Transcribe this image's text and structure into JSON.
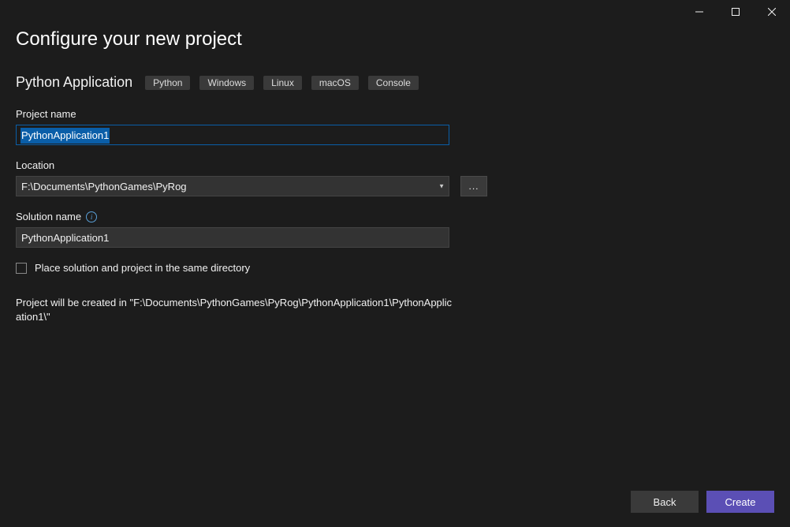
{
  "window": {
    "minimize": "–",
    "maximize": "☐",
    "close": "✕"
  },
  "heading": "Configure your new project",
  "template": {
    "name": "Python Application",
    "tags": [
      "Python",
      "Windows",
      "Linux",
      "macOS",
      "Console"
    ]
  },
  "fields": {
    "projectName": {
      "label": "Project name",
      "value": "PythonApplication1"
    },
    "location": {
      "label": "Location",
      "value": "F:\\Documents\\PythonGames\\PyRog",
      "browseLabel": "..."
    },
    "solutionName": {
      "label": "Solution name",
      "value": "PythonApplication1"
    },
    "sameDirectory": {
      "label": "Place solution and project in the same directory",
      "checked": false
    }
  },
  "pathPreview": "Project will be created in \"F:\\Documents\\PythonGames\\PyRog\\PythonApplication1\\PythonApplication1\\\"",
  "buttons": {
    "back": "Back",
    "create": "Create"
  }
}
